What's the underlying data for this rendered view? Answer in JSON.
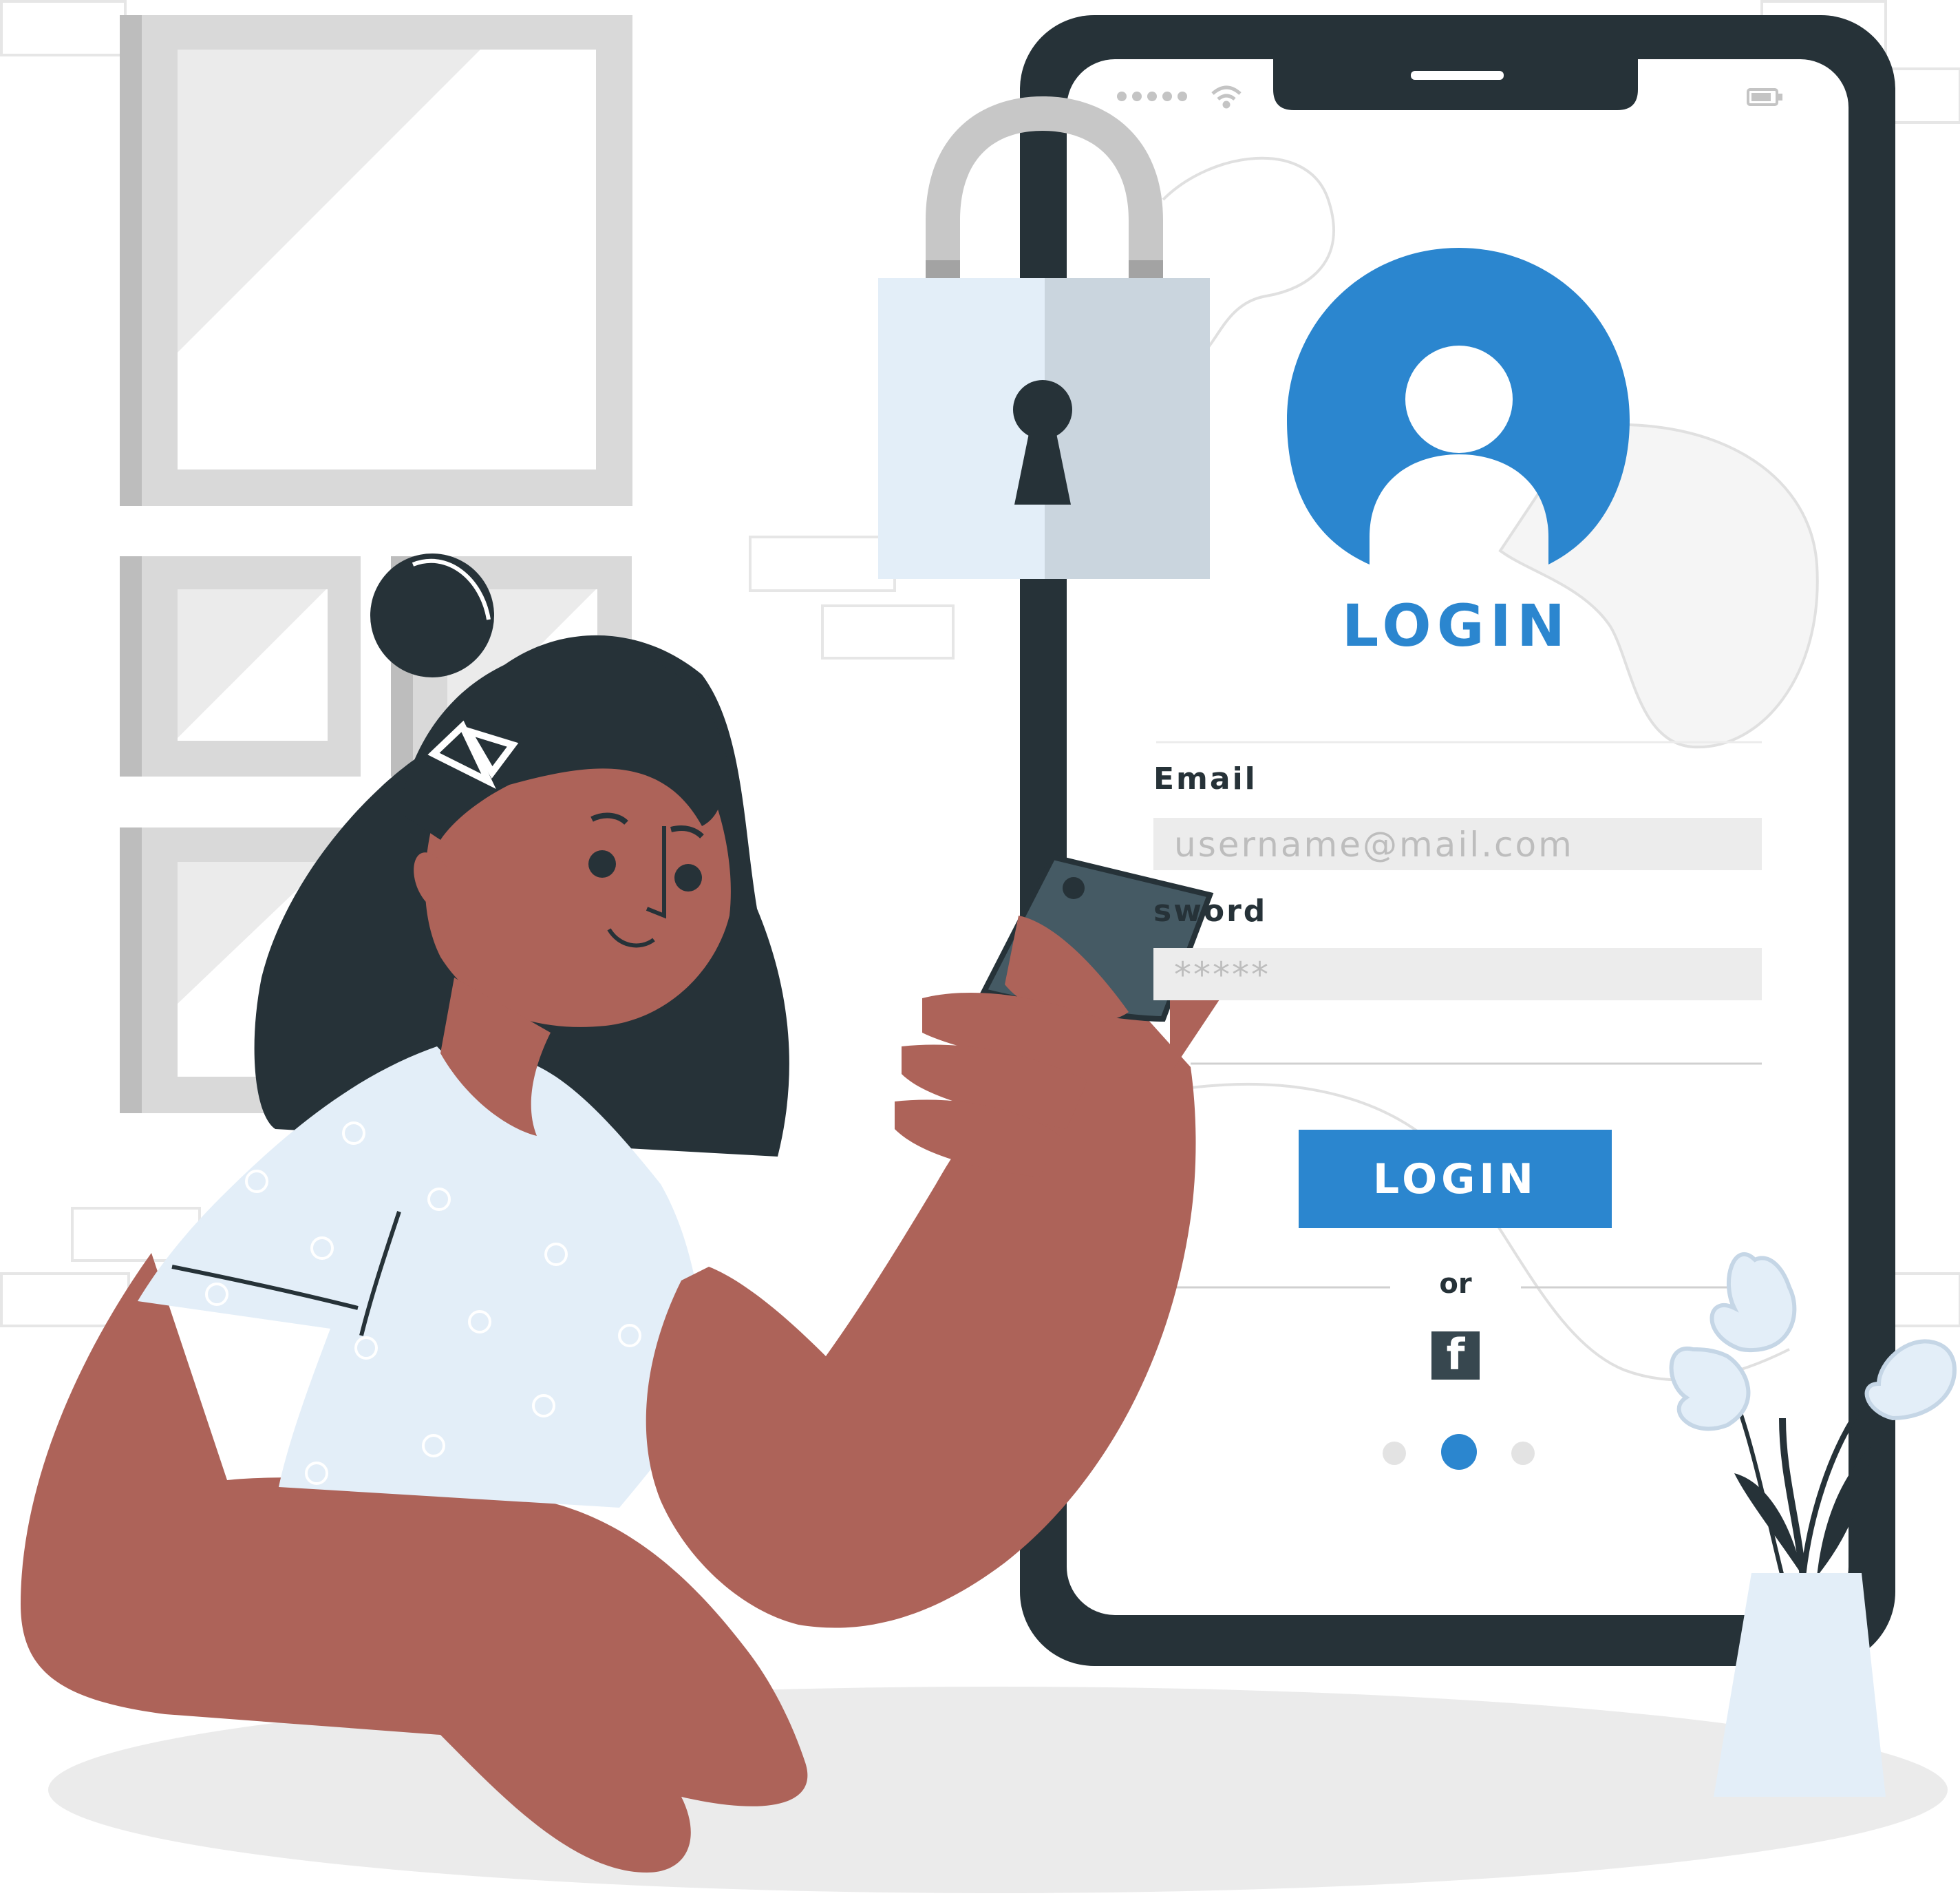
{
  "login_screen": {
    "title": "LOGIN",
    "email_label": "Email",
    "email_placeholder": "username@mail.com",
    "password_label": "sword",
    "password_value": "*****",
    "login_button": "LOGIN",
    "divider_text": "or",
    "social_icon": "facebook-icon",
    "social_glyph": "f",
    "pagination_active_index": 1
  },
  "colors": {
    "accent": "#2b86cf",
    "dark": "#263238",
    "skin": "#ad6359",
    "shirt": "#e3eef8",
    "lock_light": "#e3eef8",
    "lock_shade": "#cad5de",
    "frame_gray": "#d9d9d9",
    "field_bg": "#ececec"
  }
}
